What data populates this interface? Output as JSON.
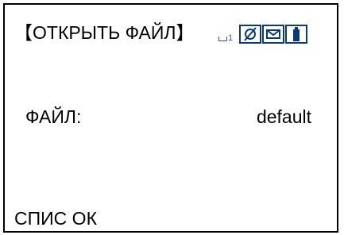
{
  "header": {
    "title": "【ОТКРЫТЬ ФАЙЛ】",
    "input_indicator_number": "1",
    "status_icons": [
      "no-signal-icon",
      "mail-icon",
      "battery-icon"
    ],
    "icon_color": "#0a3a7a"
  },
  "main": {
    "file_label": "ФАЙЛ:",
    "file_value": "default"
  },
  "softkey": {
    "left_label": "СПИС ОК"
  }
}
